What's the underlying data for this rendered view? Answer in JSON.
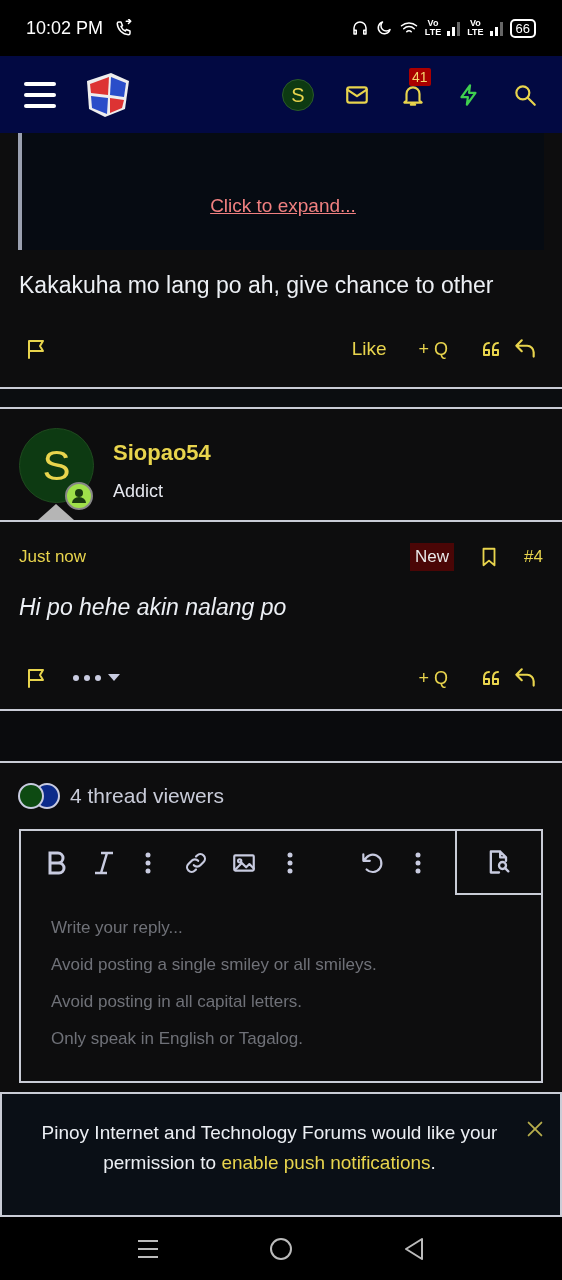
{
  "status_bar": {
    "time": "10:02 PM",
    "sims": [
      {
        "top": "Vo",
        "bottom": "LTE"
      },
      {
        "top": "Vo",
        "bottom": "LTE"
      }
    ],
    "battery": "66"
  },
  "navbar": {
    "avatar_letter": "S",
    "alerts_count": "41"
  },
  "quote": {
    "expand_link": "Click to expand..."
  },
  "posts": [
    {
      "kind": "continued",
      "body": "Kakakuha mo lang po ah, give chance to other",
      "actions": {
        "like": "Like",
        "multiquote": "+ Q"
      }
    },
    {
      "kind": "full",
      "author": "Siopao54",
      "avatar_letter": "S",
      "user_title": "Addict",
      "time": "Just now",
      "badge": "New",
      "number": "#4",
      "body": "Hi po hehe akin nalang po",
      "actions": {
        "multiquote": "+ Q"
      }
    }
  ],
  "viewers": {
    "label": "4 thread viewers"
  },
  "editor": {
    "placeholder_lines": [
      "Write your reply...",
      "Avoid posting a single smiley or all smileys.",
      "Avoid posting in all capital letters.",
      "Only speak in English or Tagalog."
    ]
  },
  "push_notice": {
    "text": "Pinoy Internet and Technology Forums would like your permission to ",
    "link": "enable push notifications",
    "end": "."
  }
}
